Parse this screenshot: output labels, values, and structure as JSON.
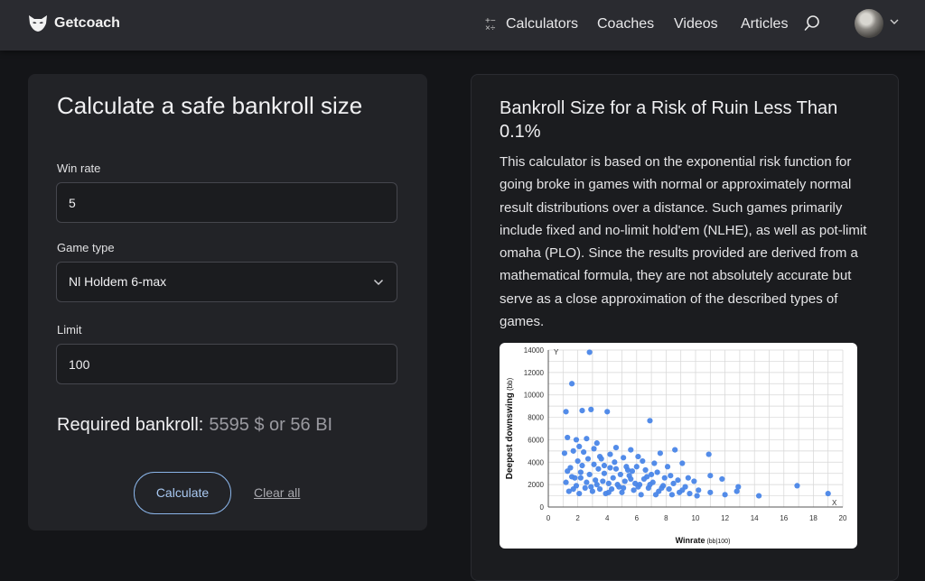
{
  "header": {
    "brand": "Getcoach",
    "nav": [
      "Calculators",
      "Coaches",
      "Videos",
      "Articles"
    ]
  },
  "form": {
    "title": "Calculate a safe bankroll size",
    "win_rate_label": "Win rate",
    "win_rate_value": "5",
    "game_type_label": "Game type",
    "game_type_value": "Nl Holdem 6-max",
    "limit_label": "Limit",
    "limit_value": "100",
    "required_label": "Required bankroll:",
    "required_value": "5595 $ or 56 BI",
    "calculate_label": "Calculate",
    "clear_label": "Clear all"
  },
  "info": {
    "title": "Bankroll Size for a Risk of Ruin Less Than 0.1%",
    "description": "This calculator is based on the exponential risk function for going broke in games with normal or approximately normal result distributions over a distance. Such games primarily include fixed and no-limit hold'em (NLHE), as well as pot-limit omaha (PLO). Since the results provided are derived from a mathematical formula, they are not absolutely accurate but serve as a close approximation of the described types of games."
  },
  "chart_data": {
    "type": "scatter",
    "xlabel": "Winrate",
    "xlabel_unit": "(bb|100)",
    "ylabel": "Deepest downswing",
    "ylabel_unit": "(bb)",
    "x_axis_letter": "X",
    "y_axis_letter": "Y",
    "xlim": [
      0,
      20
    ],
    "ylim": [
      0,
      14000
    ],
    "xticks": [
      0,
      2,
      4,
      6,
      8,
      10,
      12,
      14,
      16,
      18,
      20
    ],
    "yticks": [
      0,
      2000,
      4000,
      6000,
      8000,
      10000,
      12000,
      14000
    ],
    "grid": true,
    "point_color": "#4a86e8",
    "points": [
      [
        2.8,
        13800
      ],
      [
        1.6,
        11000
      ],
      [
        2.9,
        8700
      ],
      [
        2.3,
        8600
      ],
      [
        1.2,
        8500
      ],
      [
        4,
        8500
      ],
      [
        6.9,
        7700
      ],
      [
        1.3,
        6200
      ],
      [
        1.9,
        6000
      ],
      [
        2.6,
        6100
      ],
      [
        3.3,
        5700
      ],
      [
        4.6,
        5300
      ],
      [
        5.6,
        5100
      ],
      [
        2.1,
        5400
      ],
      [
        8.6,
        5100
      ],
      [
        10.9,
        4700
      ],
      [
        7.6,
        4800
      ],
      [
        6.1,
        4500
      ],
      [
        9.1,
        3900
      ],
      [
        3.6,
        4300
      ],
      [
        1.1,
        4800
      ],
      [
        1.7,
        5000
      ],
      [
        2.4,
        4900
      ],
      [
        3.1,
        5200
      ],
      [
        4.2,
        4700
      ],
      [
        5.1,
        4400
      ],
      [
        6.4,
        4100
      ],
      [
        7.2,
        3900
      ],
      [
        8.1,
        3600
      ],
      [
        11.8,
        2500
      ],
      [
        12.9,
        1800
      ],
      [
        14.3,
        1000
      ],
      [
        16.9,
        1900
      ],
      [
        19,
        1200
      ],
      [
        12,
        1100
      ],
      [
        11,
        2800
      ],
      [
        9.9,
        2300
      ],
      [
        10.1,
        1000
      ],
      [
        1.2,
        2200
      ],
      [
        1.5,
        3500
      ],
      [
        1.8,
        2600
      ],
      [
        2.2,
        3100
      ],
      [
        2.5,
        1700
      ],
      [
        2.8,
        2900
      ],
      [
        3.2,
        2400
      ],
      [
        3.5,
        1600
      ],
      [
        3.8,
        3000
      ],
      [
        4.1,
        2100
      ],
      [
        4.4,
        2600
      ],
      [
        4.8,
        1800
      ],
      [
        5.2,
        2300
      ],
      [
        5.5,
        2800
      ],
      [
        5.8,
        1500
      ],
      [
        6.2,
        2000
      ],
      [
        6.5,
        2500
      ],
      [
        6.8,
        1700
      ],
      [
        7.1,
        2200
      ],
      [
        7.5,
        1400
      ],
      [
        7.8,
        1900
      ],
      [
        8.2,
        1600
      ],
      [
        8.5,
        2100
      ],
      [
        8.9,
        1300
      ],
      [
        9.3,
        1800
      ],
      [
        9.6,
        1200
      ],
      [
        1.4,
        1400
      ],
      [
        1.9,
        1900
      ],
      [
        2.1,
        1200
      ],
      [
        2.6,
        2200
      ],
      [
        3,
        1400
      ],
      [
        3.4,
        3400
      ],
      [
        3.9,
        1200
      ],
      [
        4.3,
        1600
      ],
      [
        4.6,
        3400
      ],
      [
        5,
        1300
      ],
      [
        5.4,
        3300
      ],
      [
        5.9,
        2100
      ],
      [
        6.3,
        1100
      ],
      [
        6.7,
        2700
      ],
      [
        7.3,
        1100
      ],
      [
        1.3,
        3200
      ],
      [
        1.6,
        2700
      ],
      [
        2,
        4100
      ],
      [
        2.3,
        3700
      ],
      [
        2.7,
        4300
      ],
      [
        3.1,
        3800
      ],
      [
        3.5,
        4500
      ],
      [
        3.8,
        3700
      ],
      [
        4.2,
        3500
      ],
      [
        4.5,
        4000
      ],
      [
        4.9,
        2900
      ],
      [
        5.3,
        3600
      ],
      [
        5.7,
        3200
      ],
      [
        6,
        3600
      ],
      [
        6.6,
        3300
      ],
      [
        7,
        2900
      ],
      [
        7.4,
        3100
      ],
      [
        7.9,
        2600
      ],
      [
        8.3,
        2800
      ],
      [
        8.8,
        2400
      ],
      [
        9.5,
        2600
      ],
      [
        10.2,
        1500
      ],
      [
        11,
        1300
      ],
      [
        12.8,
        1400
      ],
      [
        1.7,
        1600
      ],
      [
        2.2,
        2600
      ],
      [
        2.9,
        1800
      ],
      [
        3.3,
        2000
      ],
      [
        3.7,
        2300
      ],
      [
        4.1,
        1300
      ],
      [
        4.7,
        2000
      ],
      [
        5.1,
        1700
      ],
      [
        5.6,
        2500
      ],
      [
        6.1,
        1800
      ],
      [
        6.9,
        2000
      ],
      [
        7.7,
        1700
      ],
      [
        8.4,
        1100
      ],
      [
        9.1,
        1500
      ]
    ]
  }
}
